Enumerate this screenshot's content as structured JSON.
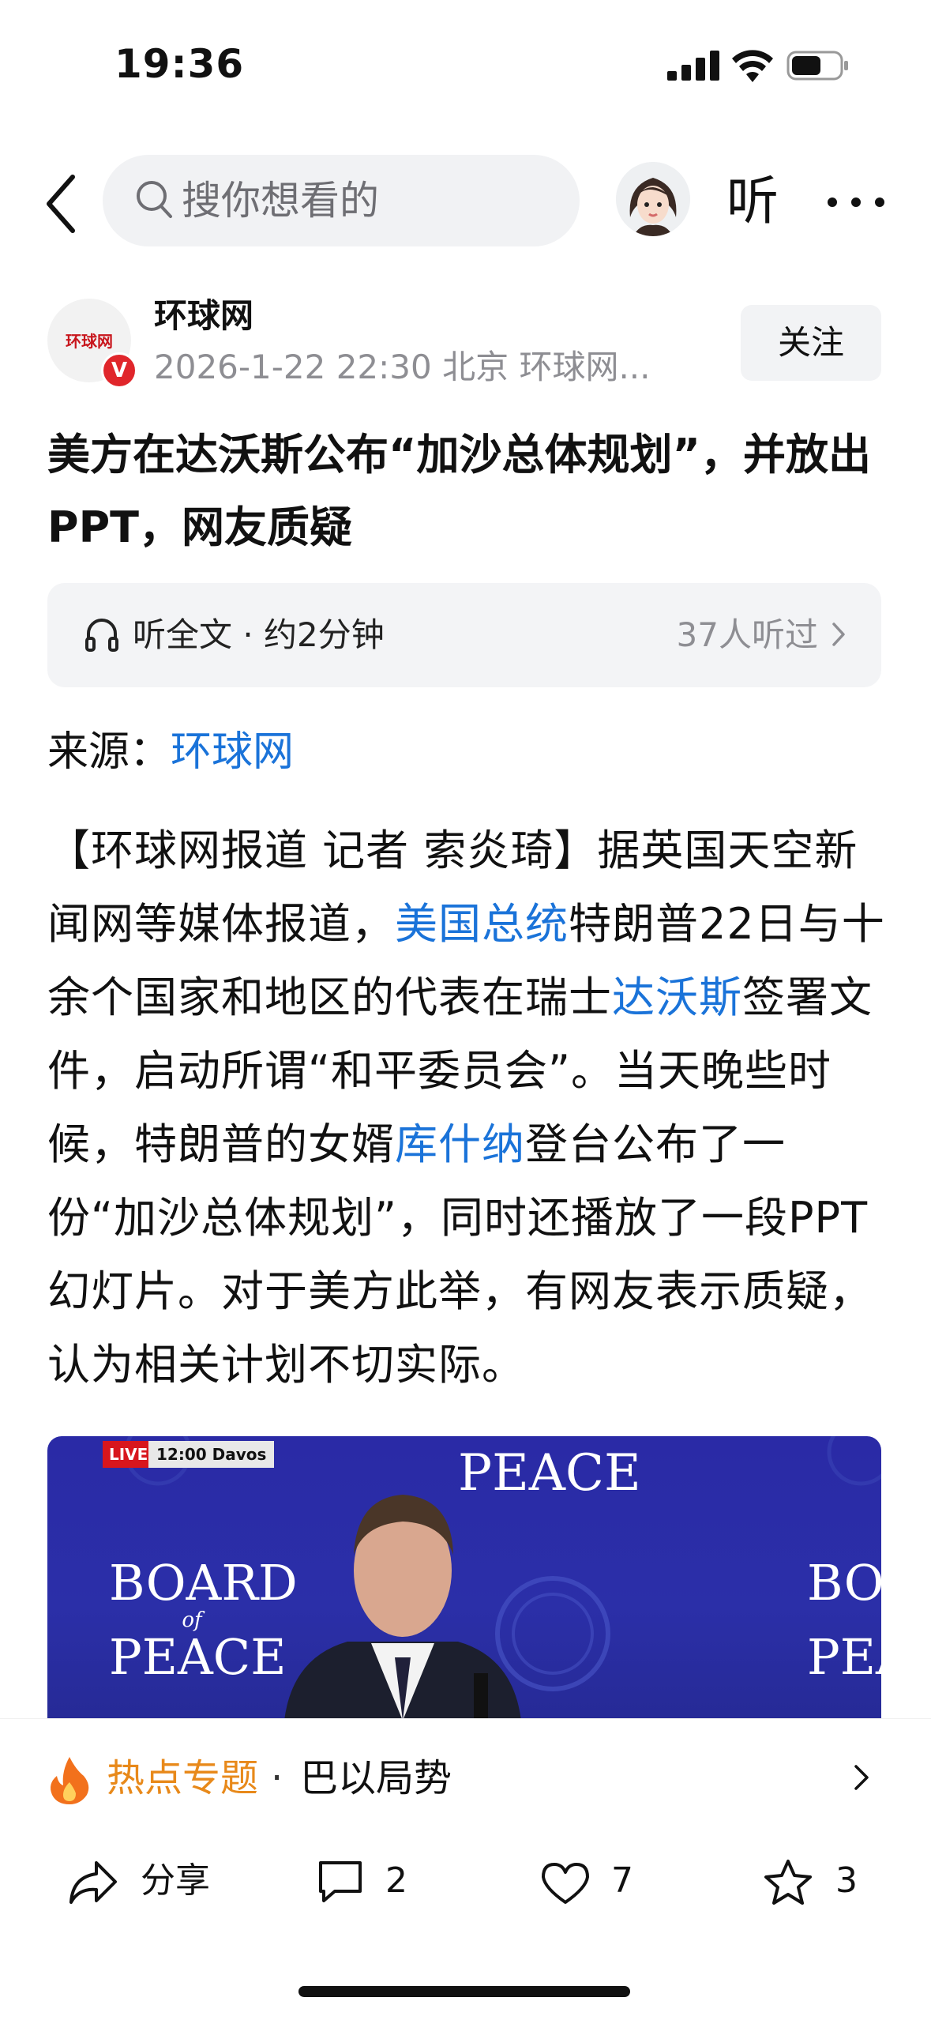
{
  "status": {
    "time": "19:36"
  },
  "nav": {
    "search_placeholder": "搜你想看的",
    "listen_label": "听"
  },
  "author": {
    "logo_text": "环球网",
    "name": "环球网",
    "meta": "2026-1-22 22:30 北京 环球网...",
    "follow_label": "关注"
  },
  "article": {
    "title": "美方在达沃斯公布“加沙总体规划”，并放出PPT，网友质疑",
    "listen_full": "听全文 · 约2分钟",
    "listen_count": "37人听过",
    "source_label": "来源：",
    "source_link": "环球网",
    "body": {
      "p1": "【环球网报道 记者 索炎琦】据英国天空新闻网等媒体报道，",
      "link1": "美国总统",
      "p2": "特朗普22日与十余个国家和地区的代表在瑞士",
      "link2": "达沃斯",
      "p3": "签署文件，启动所谓“和平委员会”。当天晚些时候，特朗普的女婿",
      "link3": "库什纳",
      "p4": "登台公布了一份“加沙总体规划”，同时还播放了一段PPT幻灯片。对于美方此举，有网友表示质疑，认为相关计划不切实际。"
    }
  },
  "photo": {
    "live": "LIVE",
    "clock": "12:00",
    "location": "Davos",
    "board_left": "BOARD",
    "of_left": "of",
    "peace_left": "PEACE",
    "peace_top": "PEACE",
    "board_right": "BOA",
    "peace_right": "PEA"
  },
  "topic": {
    "label": "热点专题",
    "dot": "·",
    "name": "巴以局势"
  },
  "actions": {
    "share": "分享",
    "comments": "2",
    "likes": "7",
    "favorites": "3"
  },
  "colors": {
    "link": "#1a73d9",
    "topic": "#e8891a",
    "verified": "#e0262b"
  }
}
